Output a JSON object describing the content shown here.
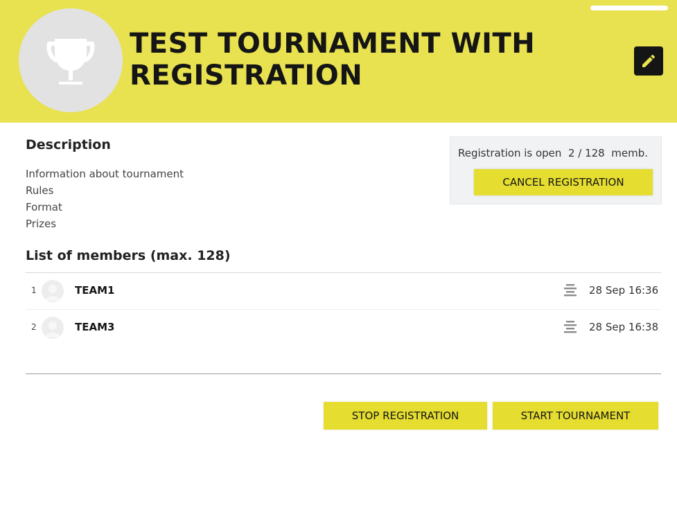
{
  "tournament": {
    "title": "TEST TOURNAMENT WITH REGISTRATION",
    "logo_icon": "trophy-icon",
    "edit_icon": "pencil-icon"
  },
  "description": {
    "heading": "Description",
    "items": [
      "Information about tournament",
      "Rules",
      "Format",
      "Prizes"
    ]
  },
  "registration": {
    "status": "Registration is open  2 / 128  memb.",
    "cancel_label": "CANCEL REGISTRATION"
  },
  "members": {
    "heading": "List of members (max. 128)",
    "rows": [
      {
        "index": "1",
        "name": "TEAM1",
        "date": "28 Sep 16:36",
        "icon": "align-center-icon"
      },
      {
        "index": "2",
        "name": "TEAM3",
        "date": "28 Sep 16:38",
        "icon": "align-center-icon"
      }
    ]
  },
  "actions": {
    "stop_label": "STOP REGISTRATION",
    "start_label": "START TOURNAMENT"
  },
  "colors": {
    "header_bg": "#e8e150",
    "button_bg": "#e5dd30",
    "title_text": "#151515"
  }
}
